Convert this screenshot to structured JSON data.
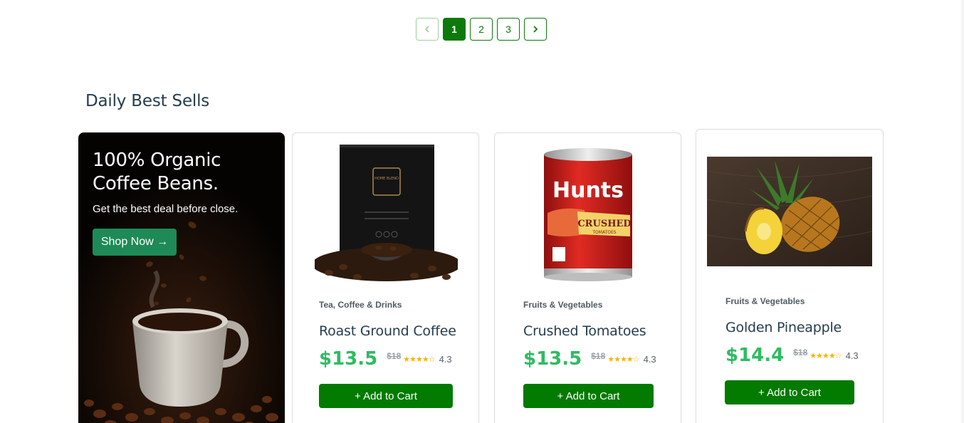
{
  "pagination": {
    "prev_icon": "chevron-left-icon",
    "next_icon": "chevron-right-icon",
    "pages": [
      "1",
      "2",
      "3"
    ],
    "active_page": 1
  },
  "section": {
    "title": "Daily Best Sells"
  },
  "promo": {
    "title": "100% Organic Coffee Beans.",
    "subtitle": "Get the best deal before close.",
    "button_label": "Shop Now →"
  },
  "products": [
    {
      "category": "Tea, Coffee & Drinks",
      "name": "Roast Ground Coffee",
      "price": "$13.5",
      "old_price": "$18",
      "stars": "★★★★☆",
      "rating": "4.3",
      "rating_value": 4.3,
      "cart_label": "+ Add to Cart"
    },
    {
      "category": "Fruits & Vegetables",
      "name": "Crushed Tomatoes",
      "price": "$13.5",
      "old_price": "$18",
      "stars": "★★★★☆",
      "rating": "4.3",
      "rating_value": 4.3,
      "cart_label": "+ Add to Cart"
    },
    {
      "category": "Fruits & Vegetables",
      "name": "Golden Pineapple",
      "price": "$14.4",
      "old_price": "$18",
      "stars": "★★★★☆",
      "rating": "4.3",
      "rating_value": 4.3,
      "cart_label": "+ Add to Cart"
    }
  ],
  "coffee_can": {
    "brand": "HOME BLEND"
  },
  "tomato_can": {
    "brand": "Hunts",
    "label": "CRUSHED",
    "sub_label": "TOMATOES"
  },
  "colors": {
    "accent": "#0b7a0b",
    "price": "#2ebc62",
    "promo_button": "#1e8a57",
    "cart_button": "#037a00"
  }
}
